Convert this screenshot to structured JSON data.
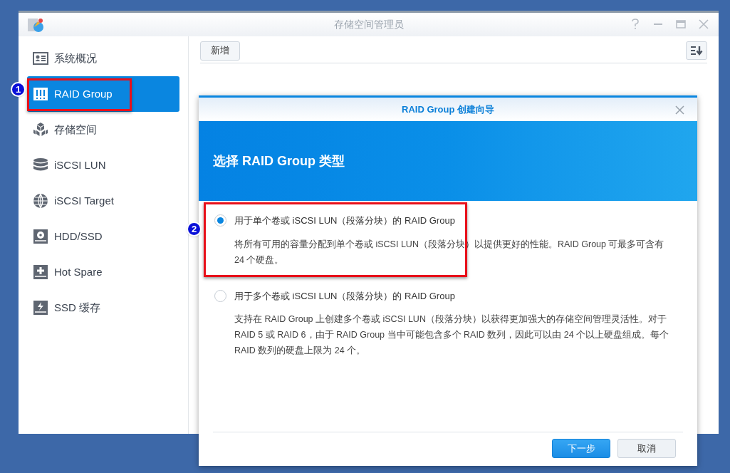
{
  "window": {
    "title": "存储空间管理员"
  },
  "sidebar": {
    "items": [
      {
        "kind": "overview",
        "label": "系统概况",
        "selected": false
      },
      {
        "kind": "raid",
        "label": "RAID Group",
        "selected": true
      },
      {
        "kind": "storage",
        "label": "存储空间",
        "selected": false
      },
      {
        "kind": "lun",
        "label": "iSCSI LUN",
        "selected": false
      },
      {
        "kind": "target",
        "label": "iSCSI Target",
        "selected": false
      },
      {
        "kind": "disk",
        "label": "HDD/SSD",
        "selected": false
      },
      {
        "kind": "spare",
        "label": "Hot Spare",
        "selected": false
      },
      {
        "kind": "cache",
        "label": "SSD 缓存",
        "selected": false
      }
    ]
  },
  "toolbar": {
    "create_button": "新增"
  },
  "dialog": {
    "title": "RAID Group 创建向导",
    "heading": "选择 RAID Group 类型",
    "options": [
      {
        "label": "用于单个卷或 iSCSI LUN（段落分块）的 RAID Group",
        "description": "将所有可用的容量分配到单个卷或 iSCSI LUN（段落分块）以提供更好的性能。RAID Group 可最多可含有 24 个硬盘。",
        "selected": true
      },
      {
        "label": "用于多个卷或 iSCSI LUN（段落分块）的 RAID Group",
        "description": "支持在 RAID Group 上创建多个卷或 iSCSI LUN（段落分块）以获得更加强大的存储空间管理灵活性。对于RAID 5 或 RAID 6，由于 RAID Group 当中可能包含多个 RAID 数列，因此可以由 24 个以上硬盘组成。每个 RAID 数列的硬盘上限为 24 个。",
        "selected": false
      }
    ],
    "buttons": {
      "next": "下一步",
      "cancel": "取消"
    }
  },
  "annotations": [
    {
      "number": "1"
    },
    {
      "number": "2"
    }
  ]
}
